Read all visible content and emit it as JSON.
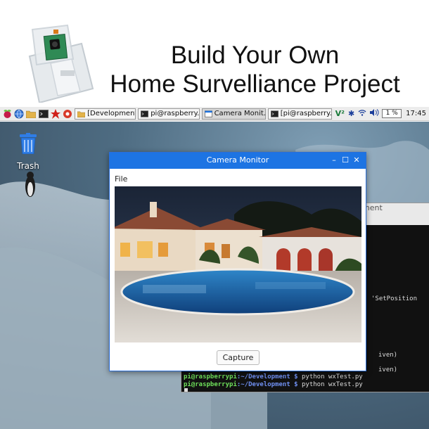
{
  "banner": {
    "headline_line1": "Build Your Own",
    "headline_line2": "Home Survelliance Project"
  },
  "taskbar": {
    "tasks": [
      {
        "label": "[Development]",
        "icon": "folder-icon"
      },
      {
        "label": "pi@raspberry...",
        "icon": "terminal-icon"
      },
      {
        "label": "Camera Monit...",
        "icon": "window-icon"
      },
      {
        "label": "[pi@raspberry...",
        "icon": "terminal-icon"
      }
    ],
    "cpu": "1 %",
    "clock": "17:45"
  },
  "desktop": {
    "trash_label": "Trash"
  },
  "terminal": {
    "title_fragment": "ment",
    "lines": [
      {
        "text": "'SetPosition",
        "kind": "plain"
      },
      {
        "text": "iven)",
        "kind": "plain"
      },
      {
        "text": "iven)",
        "kind": "plain"
      },
      {
        "user": "pi@raspberrypi",
        "path": ":~/Development $",
        "cmd": " python wxTest.py",
        "kind": "prompt"
      },
      {
        "user": "pi@raspberrypi",
        "path": ":~/Development $",
        "cmd": " python wxTest.py",
        "kind": "prompt"
      }
    ]
  },
  "camera_window": {
    "title": "Camera Monitor",
    "menu_file": "File",
    "capture_label": "Capture",
    "buttons": {
      "minimize": "–",
      "maximize": "☐",
      "close": "✕"
    }
  },
  "colors": {
    "titlebar": "#1d74e3",
    "accent": "#1d74e3",
    "terminal_bg": "#111111"
  }
}
